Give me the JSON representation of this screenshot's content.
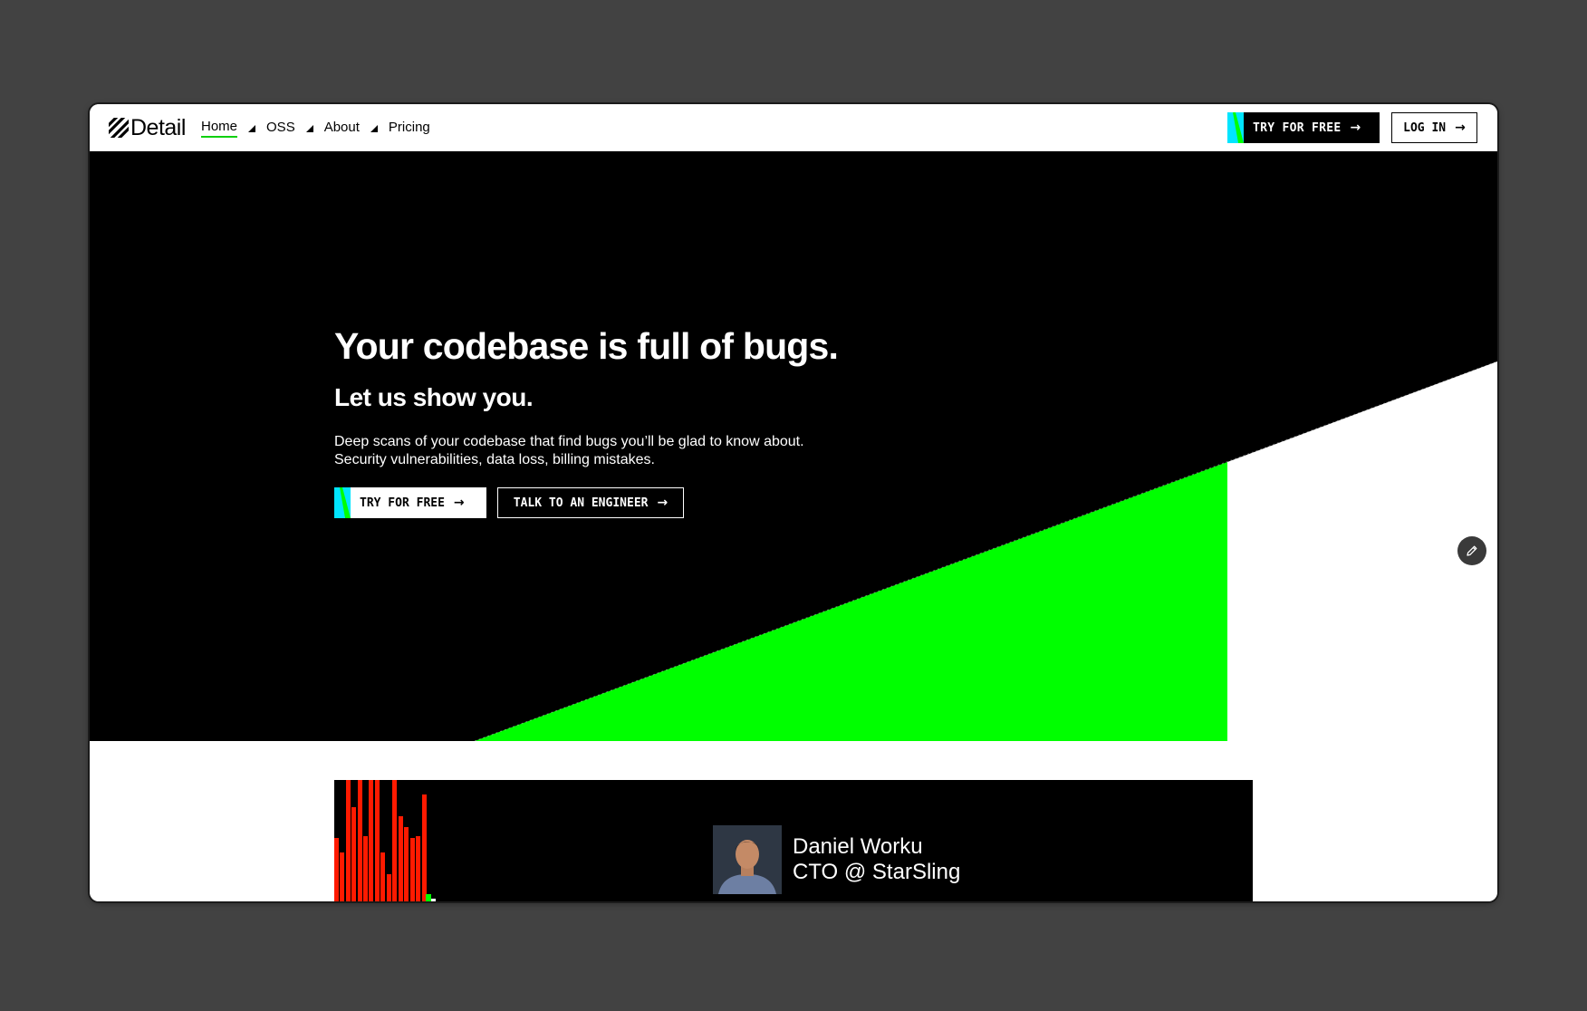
{
  "brand": {
    "name": "Detail"
  },
  "nav": {
    "links": [
      {
        "label": "Home",
        "active": true
      },
      {
        "label": "OSS",
        "active": false
      },
      {
        "label": "About",
        "active": false
      },
      {
        "label": "Pricing",
        "active": false
      }
    ],
    "try_label": "TRY FOR FREE",
    "login_label": "LOG IN"
  },
  "hero": {
    "title": "Your codebase is full of bugs.",
    "subtitle": "Let us show you.",
    "description_line1": "Deep scans of your codebase that find bugs you’ll be glad to know about.",
    "description_line2": "Security vulnerabilities, data loss, billing mistakes.",
    "try_label": "TRY FOR FREE",
    "talk_label": "TALK TO AN ENGINEER"
  },
  "testimonial": {
    "name": "Daniel Worku",
    "role": "CTO @ StarSling"
  },
  "icons": {
    "arrow": "arrow-right-icon",
    "edit": "pencil-icon",
    "logo": "hatched-square-icon"
  },
  "colors": {
    "accent_green": "#00ff00",
    "accent_cyan": "#00e5ff",
    "alert_red": "#ff1a00",
    "background": "#000000"
  }
}
